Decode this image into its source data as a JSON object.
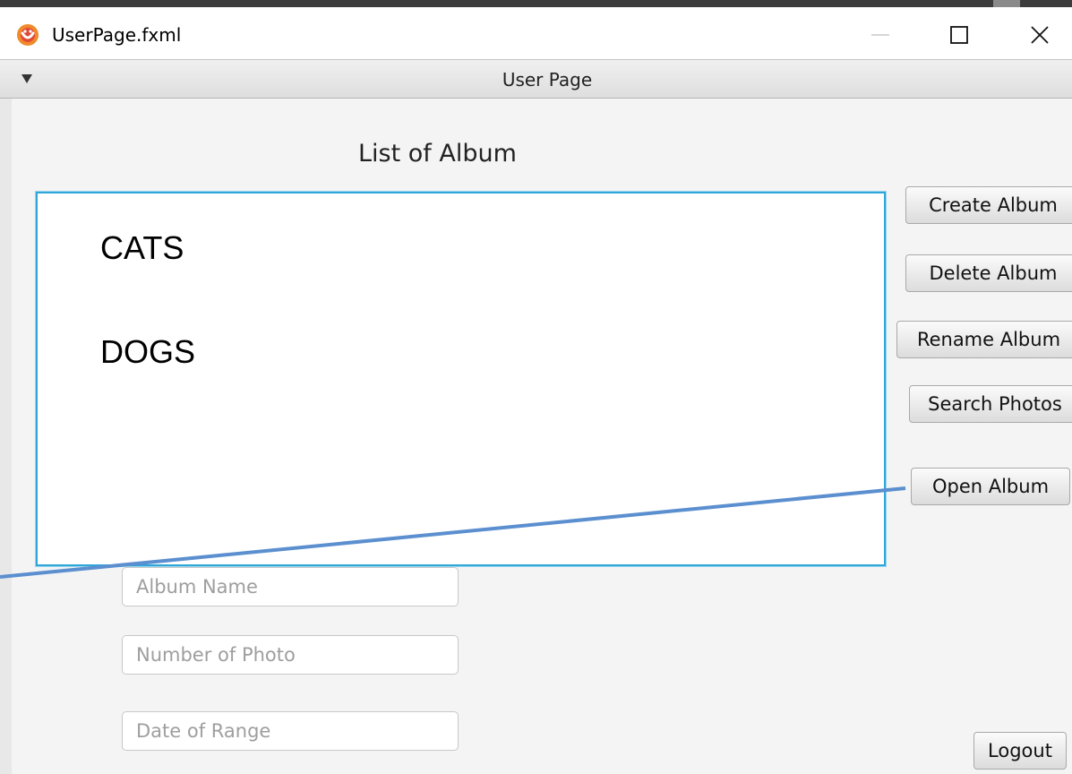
{
  "window": {
    "title": "UserPage.fxml"
  },
  "pane": {
    "title": "User Page"
  },
  "main": {
    "list_heading": "List of Album",
    "albums": [
      "CATS",
      "DOGS"
    ]
  },
  "actions": {
    "create": "Create Album",
    "delete": "Delete Album",
    "rename": "Rename Album",
    "search": "Search Photos",
    "open": "Open Album",
    "logout": "Logout"
  },
  "fields": {
    "album_name_placeholder": "Album Name",
    "number_of_photo_placeholder": "Number of Photo",
    "date_of_range_placeholder": "Date of Range"
  },
  "colors": {
    "list_focus": "#2fa7d8",
    "annotation_line": "#5b8fcf"
  },
  "icons": {
    "app": "java-duke-icon",
    "minimize": "minimize-icon",
    "maximize": "maximize-icon",
    "close": "close-icon",
    "collapse": "collapse-arrow-icon"
  }
}
